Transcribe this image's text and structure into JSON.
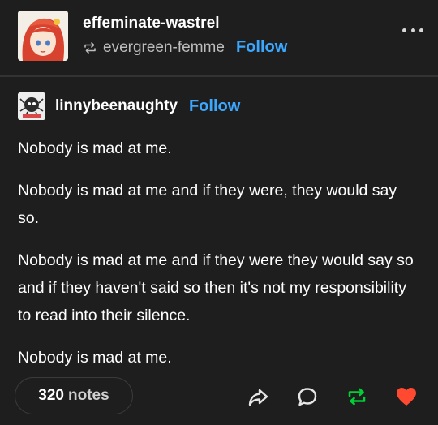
{
  "post": {
    "blog_name": "effeminate-wastrel",
    "reblogged_from": "evergreen-femme",
    "follow_label": "Follow",
    "more_icon": "ellipsis-icon"
  },
  "trail": {
    "blog_name": "linnybeenaughty",
    "follow_label": "Follow",
    "paragraphs": [
      "Nobody is mad at me.",
      "Nobody is mad at me and if they were, they would say so.",
      "Nobody is mad at me and if they were they would say so and if they haven't said so then it's not my responsibility to read into their silence.",
      "Nobody is mad at me."
    ]
  },
  "footer": {
    "notes_count": "320",
    "notes_label": "notes",
    "actions": [
      "share-icon",
      "reply-icon",
      "reblog-icon",
      "like-icon"
    ]
  },
  "colors": {
    "background": "#1e1e1e",
    "follow": "#3ba7ff",
    "reblog": "#00cf35",
    "like": "#ff4930"
  }
}
